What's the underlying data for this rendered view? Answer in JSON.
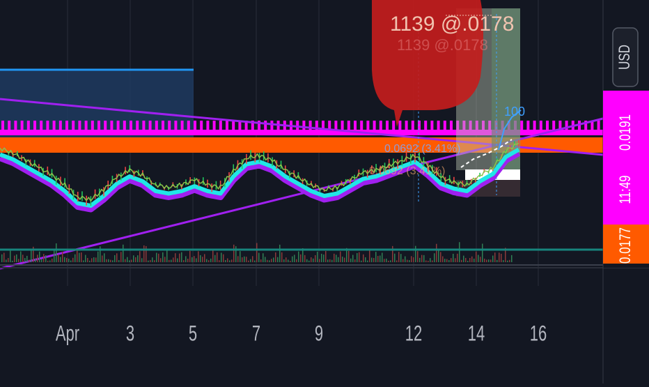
{
  "currency_label": "USD",
  "price_labels": {
    "upper": "0.0191",
    "countdown": "11:49",
    "lower": "0.0177"
  },
  "annotations": {
    "bubble_text": "1139 @.0178",
    "projection_text": "0.0692 (3.41%)",
    "target_text": "100"
  },
  "colors": {
    "background": "#131722",
    "magenta": "#ff00ff",
    "orange": "#ff5a00",
    "purple": "#a020f0",
    "cyan": "#21e6e6",
    "blue": "#2196f3",
    "red_bubble": "#c31d1d",
    "teal": "#17857d",
    "candle_up": "#22c55e",
    "candle_down": "#ef4444"
  },
  "chart_data": {
    "type": "line",
    "x_tick_labels": [
      "Apr",
      "3",
      "5",
      "7",
      "9",
      "12",
      "14",
      "16"
    ],
    "series": [
      {
        "values": [
          0.01875,
          0.01865,
          0.0185,
          0.01835,
          0.0182,
          0.018,
          0.01775,
          0.0177,
          0.0179,
          0.01815,
          0.0183,
          0.0182,
          0.018,
          0.01795,
          0.018,
          0.0181,
          0.018,
          0.01795,
          0.0183,
          0.01855,
          0.0186,
          0.0185,
          0.0183,
          0.01815,
          0.018,
          0.0179,
          0.01795,
          0.0181,
          0.01825,
          0.0183,
          0.0184,
          0.0185,
          0.0186,
          0.0184,
          0.01815,
          0.01805,
          0.018,
          0.0182,
          0.01835,
          0.0187,
          0.01885
        ]
      }
    ]
  }
}
